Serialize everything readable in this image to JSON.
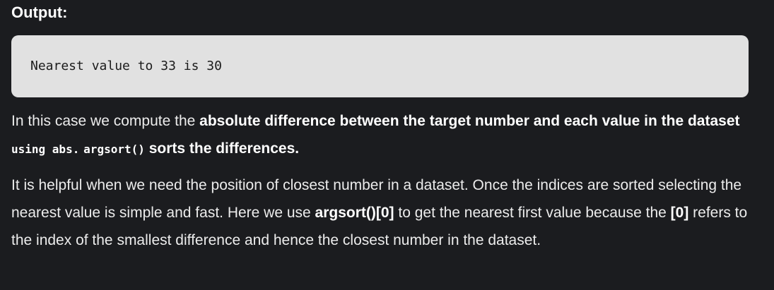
{
  "heading": "Output:",
  "code_output": "Nearest value to 33 is 30",
  "paragraph1": {
    "t1": "In this case we compute the ",
    "b1": "absolute difference between the target number and each value in the dataset ",
    "c1": "using abs.",
    "s1": " ",
    "c2": "argsort()",
    "b2": " sorts the differences."
  },
  "paragraph2": {
    "t1": "It is helpful when we need the position of closest number in a dataset. Once the indices are sorted selecting the nearest value is simple and fast. Here we use ",
    "b1": "argsort()[0]",
    "t2": " to get the nearest first value because the ",
    "b2": "[0]",
    "t3": " refers to the index of the smallest difference and hence the closest number in the dataset."
  }
}
